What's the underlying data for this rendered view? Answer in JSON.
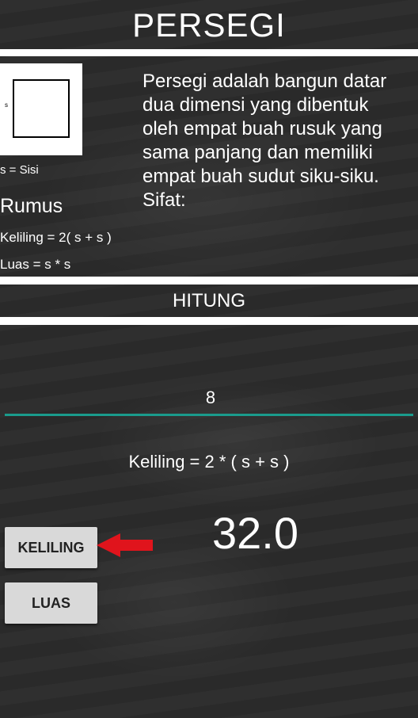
{
  "header": {
    "title": "PERSEGI"
  },
  "info": {
    "diagram_label": "s",
    "legend": "s = Sisi",
    "description": "Persegi adalah bangun datar dua dimensi yang dibentuk oleh empat buah rusuk yang sama panjang dan memiliki empat buah sudut siku-siku. Sifat:",
    "rumus_heading": "Rumus",
    "keliling_formula": "Keliling = 2( s + s )",
    "luas_formula": "Luas = s * s"
  },
  "calc": {
    "section_label": "HITUNG",
    "input_value": "8",
    "formula": "Keliling = 2 * ( s + s )",
    "result": "32.0"
  },
  "buttons": {
    "keliling": "KELILING",
    "luas": "LUAS"
  },
  "colors": {
    "accent": "#1a9b8c",
    "arrow": "#e0141c",
    "background": "#2b2b2b"
  }
}
